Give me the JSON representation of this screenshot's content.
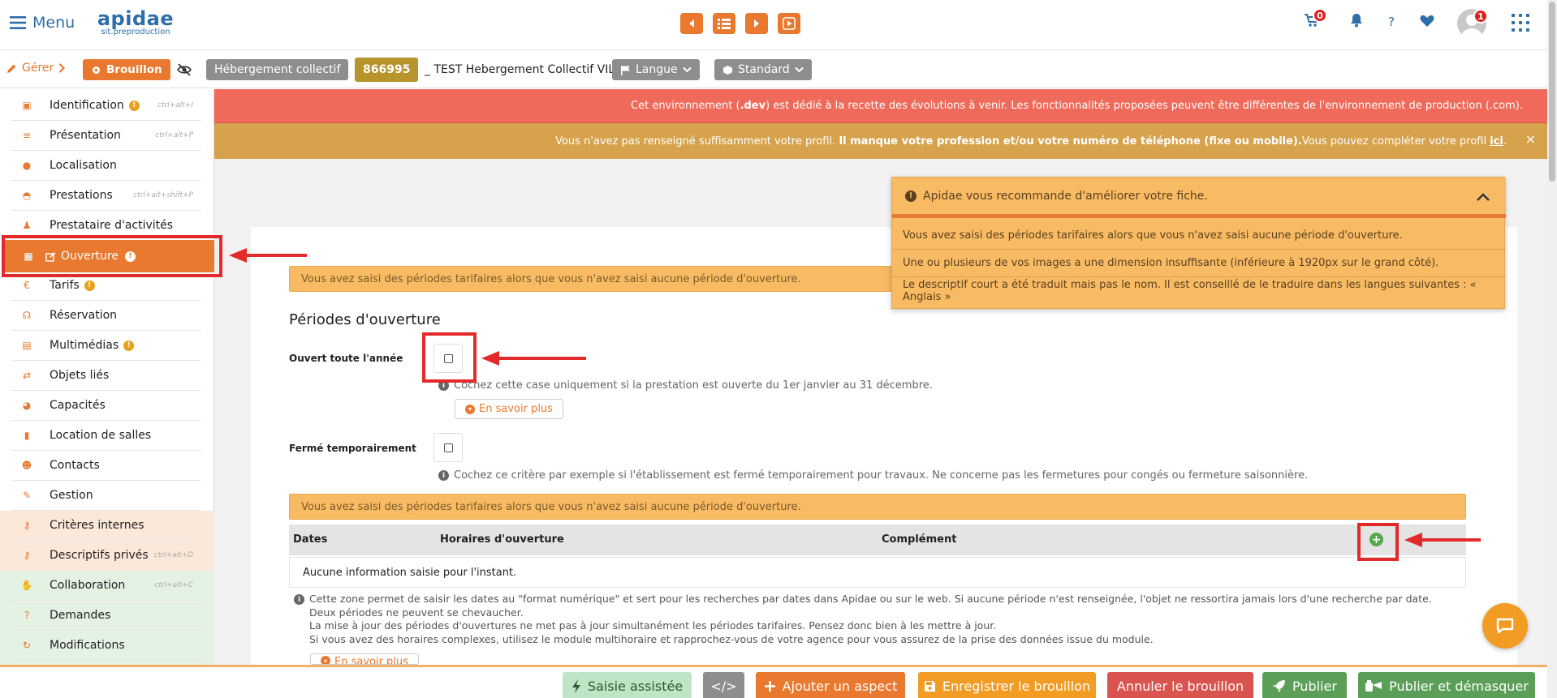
{
  "header": {
    "menu_label": "Menu",
    "logo_name": "apidae",
    "logo_sub": "sit.preproduction",
    "cart_badge": "0",
    "help_label": "?",
    "avatar_badge": "1"
  },
  "toolbar": {
    "gerer_label": "Gérer",
    "status_label": "Brouillon",
    "type_label": "Hébergement collectif",
    "object_id": "866995",
    "object_title": "_ TEST Hebergement Collectif VIL",
    "langue_label": "Langue",
    "standard_label": "Standard"
  },
  "sidebar": {
    "items": [
      {
        "label": "Identification",
        "shortcut": "ctrl+alt+I",
        "badge": "!",
        "icon": "id-card-icon"
      },
      {
        "label": "Présentation",
        "shortcut": "ctrl+alt+P",
        "icon": "list-icon"
      },
      {
        "label": "Localisation",
        "icon": "map-pin-icon"
      },
      {
        "label": "Prestations",
        "shortcut": "ctrl+alt+shift+P",
        "icon": "bell-service-icon"
      },
      {
        "label": "Prestataire d'activités",
        "icon": "hiker-icon"
      },
      {
        "label": "Ouverture",
        "badge": "!",
        "icon": "calendar-icon",
        "active": true
      },
      {
        "label": "Tarifs",
        "badge": "!",
        "icon": "euro-icon"
      },
      {
        "label": "Réservation",
        "icon": "headset-icon"
      },
      {
        "label": "Multimédias",
        "badge": "!",
        "icon": "images-icon"
      },
      {
        "label": "Objets liés",
        "icon": "exchange-icon"
      },
      {
        "label": "Capacités",
        "icon": "gauge-icon"
      },
      {
        "label": "Location de salles",
        "icon": "bookmark-icon"
      },
      {
        "label": "Contacts",
        "icon": "users-icon"
      },
      {
        "label": "Gestion",
        "icon": "wrench-icon"
      },
      {
        "label": "Critères internes",
        "icon": "key-icon"
      },
      {
        "label": "Descriptifs privés",
        "shortcut": "ctrl+alt+D",
        "icon": "key-icon"
      },
      {
        "label": "Collaboration",
        "shortcut": "ctrl+alt+C",
        "icon": "handshake-icon"
      },
      {
        "label": "Demandes",
        "icon": "question-icon"
      },
      {
        "label": "Modifications",
        "icon": "sync-icon"
      }
    ]
  },
  "alerts": {
    "dev_env_pre": "Cet environnement (",
    "dev_env_bold": ".dev",
    "dev_env_post": ") est dédié à la recette des évolutions à venir. Les fonctionnalités proposées peuvent être différentes de l'environnement de production (.com).",
    "profile_pre": "Vous n'avez pas renseigné suffisamment votre profil. ",
    "profile_bold": "Il manque votre profession et/ou votre numéro de téléphone (fixe ou mobile).",
    "profile_post": "Vous pouvez compléter votre profil ",
    "profile_link": "ici",
    "close": "×"
  },
  "recommend": {
    "title": "Apidae vous recommande d'améliorer votre fiche.",
    "items": [
      "Vous avez saisi des périodes tarifaires alors que vous n'avez saisi aucune période d'ouverture.",
      "Une ou plusieurs de vos images a une dimension insuffisante (inférieure à 1920px sur le grand côté).",
      "Le descriptif court a été traduit mais pas le nom. Il est conseillé de le traduire dans les langues suivantes : « Anglais »"
    ]
  },
  "form": {
    "warning_1": "Vous avez saisi des périodes tarifaires alors que vous n'avez saisi aucune période d'ouverture.",
    "section_title": "Périodes d'ouverture",
    "open_all_year_label": "Ouvert toute l'année",
    "open_all_year_help": "Cochez cette case uniquement si la prestation est ouverte du 1er janvier au 31 décembre.",
    "learn_more": "En savoir plus",
    "closed_temp_label": "Fermé temporairement",
    "closed_temp_help": "Cochez ce critère par exemple si l'établissement est fermé temporairement pour travaux. Ne concerne pas les fermetures pour congés ou fermeture saisonnière.",
    "warning_2": "Vous avez saisi des périodes tarifaires alors que vous n'avez saisi aucune période d'ouverture.",
    "table_headers": [
      "Dates",
      "Horaires d'ouverture",
      "Complément"
    ],
    "table_empty": "Aucune information saisie pour l'instant.",
    "notes": [
      "Cette zone permet de saisir les dates au \"format numérique\" et sert pour les recherches par dates dans Apidae ou sur le web. Si aucune période n'est renseignée, l'objet ne ressortira jamais lors d'une recherche par date.",
      "Deux périodes ne peuvent se chevaucher.",
      "La mise à jour des périodes d'ouvertures ne met pas à jour simultanément les périodes tarifaires. Pensez donc bien à les mettre à jour.",
      "Si vous avez des horaires complexes, utilisez le module multihoraire et rapprochez-vous de votre agence pour vous assurez de la prise des données issue du module."
    ],
    "learn_more_2": "En savoir plus"
  },
  "bottom": {
    "assist": "Saisie assistée",
    "code": "</>",
    "add_aspect": "Ajouter un aspect",
    "save_draft": "Enregistrer le brouillon",
    "cancel_draft": "Annuler le brouillon",
    "publish": "Publier",
    "publish_unmask": "Publier et démasquer"
  },
  "colors": {
    "accent": "#e8792e",
    "brand_blue": "#2d6ea8",
    "alert_red": "#ef6a5a",
    "alert_gold": "#d7a24c",
    "warning": "#f8bb63",
    "success": "#58a84e",
    "danger": "#d9534f",
    "annotation_red": "#e32a2a"
  }
}
